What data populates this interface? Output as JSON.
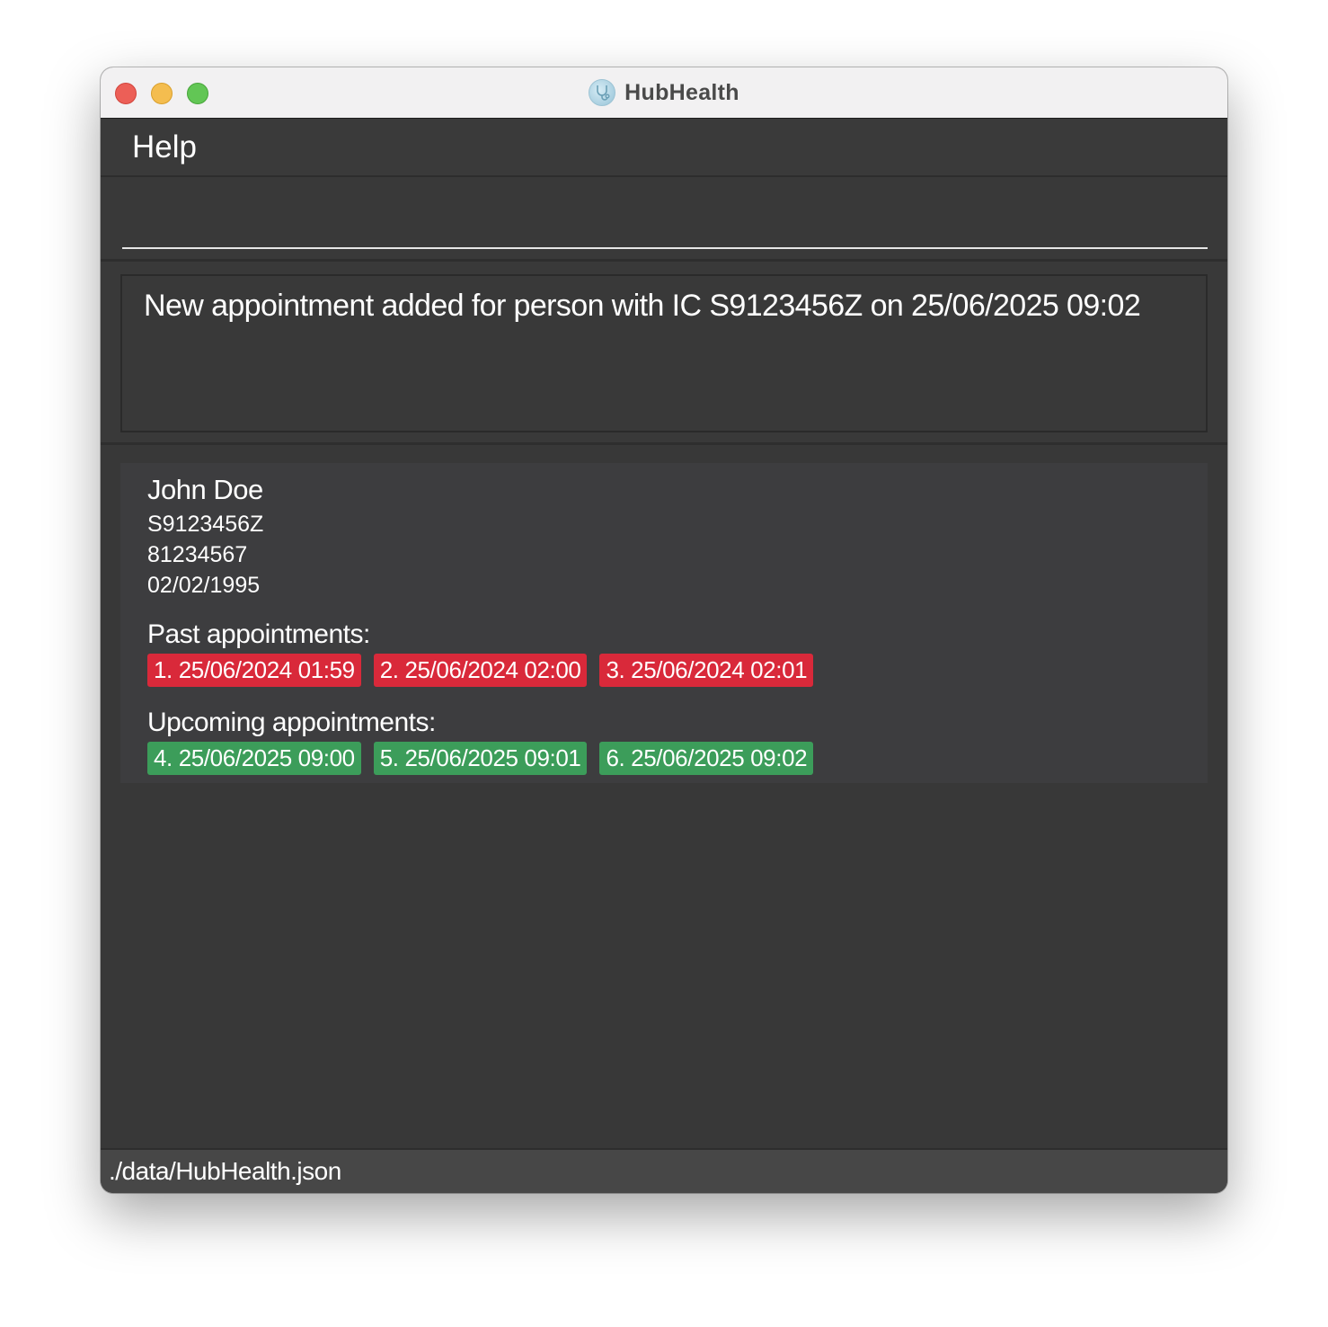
{
  "window": {
    "title": "HubHealth",
    "icon": "stethoscope-icon"
  },
  "menu": {
    "items": [
      {
        "label": "Help"
      }
    ]
  },
  "command": {
    "value": "",
    "placeholder": ""
  },
  "result": {
    "message": "New appointment added for person with IC S9123456Z on 25/06/2025 09:02"
  },
  "persons": [
    {
      "name": "John Doe",
      "ic": "S9123456Z",
      "phone": "81234567",
      "dob": "02/02/1995",
      "past_label": "Past appointments:",
      "past_appointments": [
        "1. 25/06/2024 01:59",
        "2. 25/06/2024 02:00",
        "3. 25/06/2024 02:01"
      ],
      "upcoming_label": "Upcoming appointments:",
      "upcoming_appointments": [
        "4. 25/06/2025 09:00",
        "5. 25/06/2025 09:01",
        "6. 25/06/2025 09:02"
      ]
    }
  ],
  "status": {
    "file_path": "./data/HubHealth.json"
  },
  "colors": {
    "past_tag": "#d9293a",
    "upcoming_tag": "#3c9d5a",
    "background": "#383838",
    "card": "#3d3d3f"
  }
}
